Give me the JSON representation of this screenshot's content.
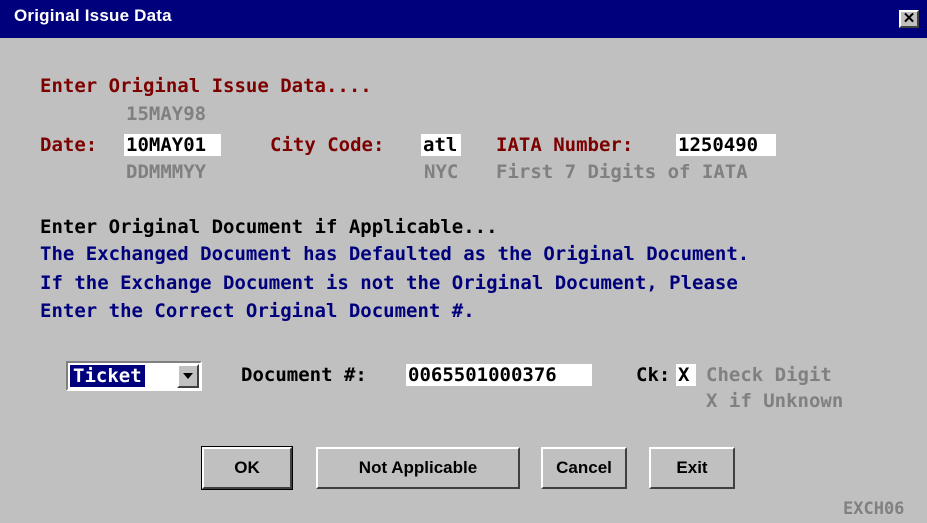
{
  "window": {
    "title": "Original Issue Data",
    "close_label": "✕"
  },
  "section1": {
    "heading": "Enter Original Issue Data....",
    "original_date": "15MAY98",
    "date_label": "Date:",
    "date_value": "10MAY01",
    "date_hint": "DDMMMYY",
    "city_label": "City Code:",
    "city_value": "atl",
    "city_hint": "NYC",
    "iata_label": "IATA Number:",
    "iata_value": "1250490",
    "iata_hint": "First 7 Digits of IATA"
  },
  "section2": {
    "heading": "Enter Original Document if Applicable...",
    "info_lines": [
      "The Exchanged Document has Defaulted as the Original Document.",
      "If the Exchange Document is not the Original Document, Please",
      "Enter the Correct Original Document #."
    ]
  },
  "document": {
    "type_selected": "Ticket",
    "doc_label": "Document #:",
    "doc_value": "0065501000376",
    "ck_label": "Ck:",
    "ck_value": "X",
    "ck_hint1": "Check Digit",
    "ck_hint2": "X if Unknown"
  },
  "buttons": {
    "ok": "OK",
    "not_applicable": "Not Applicable",
    "cancel": "Cancel",
    "exit": "Exit"
  },
  "footer_code": "EXCH06"
}
